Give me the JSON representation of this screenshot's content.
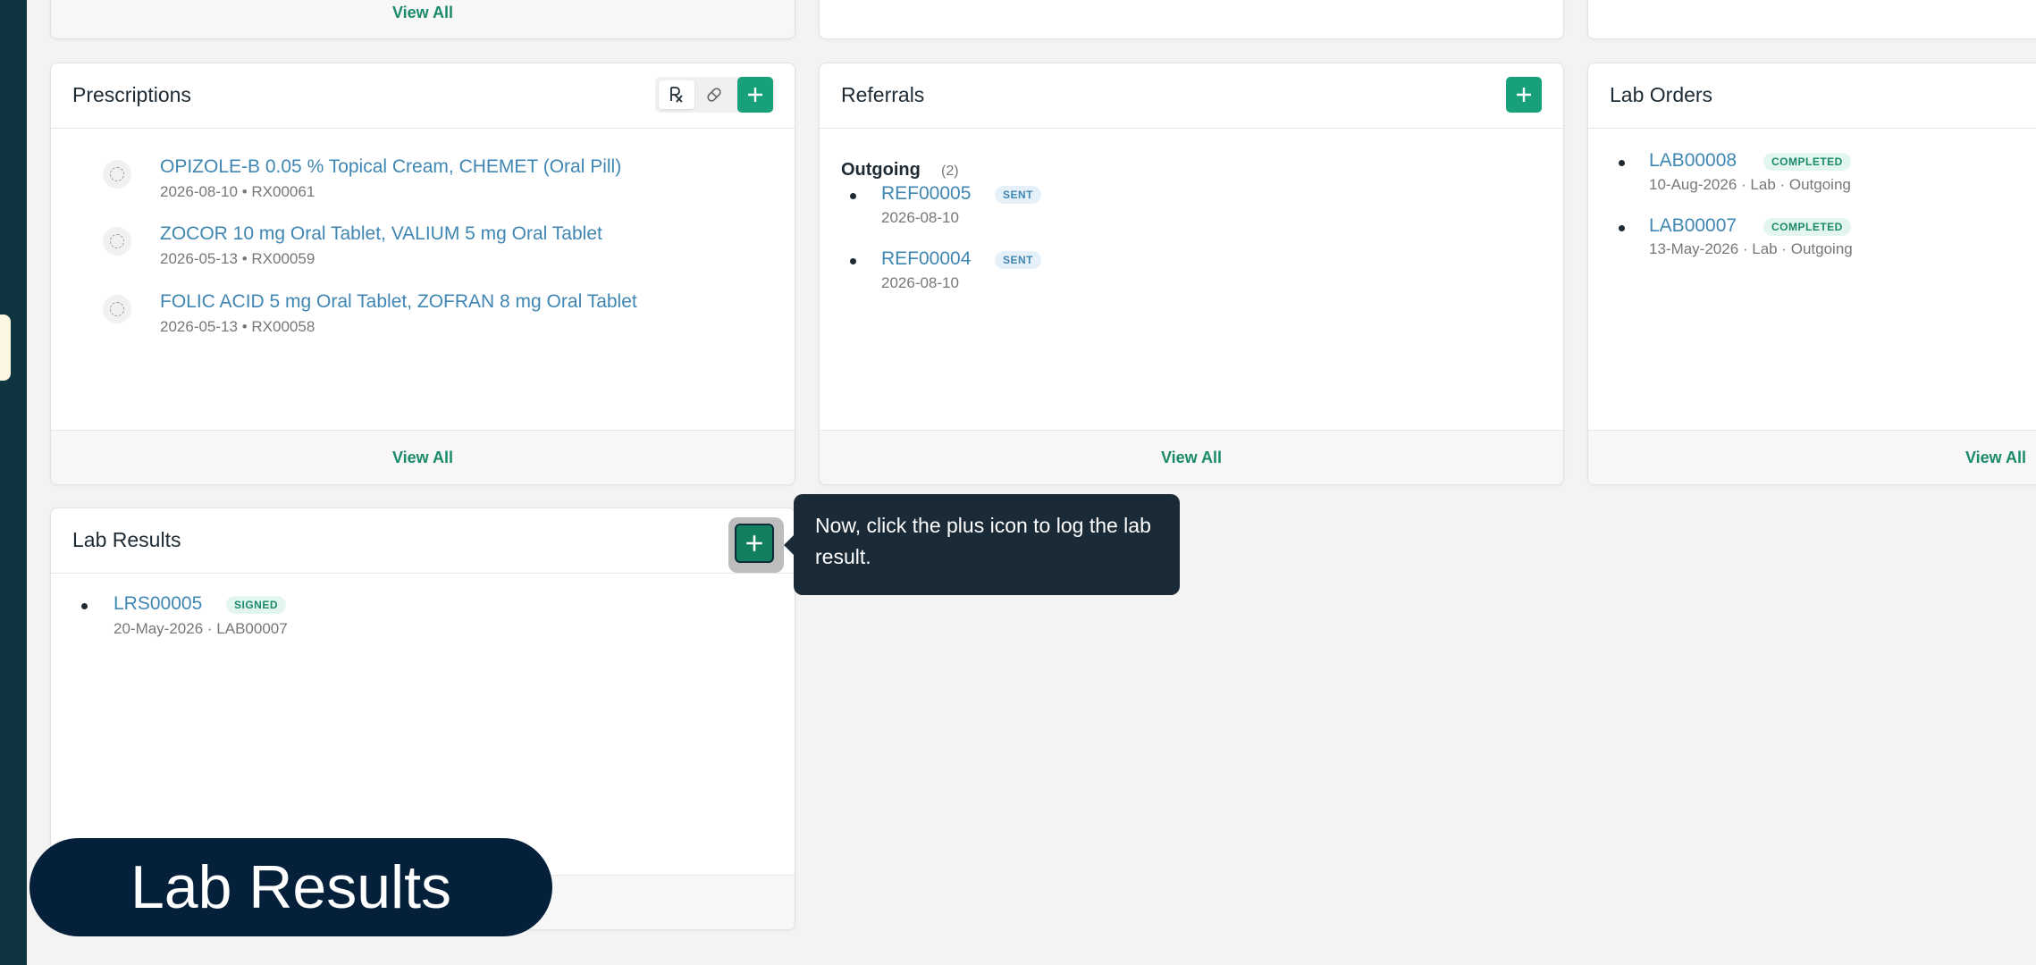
{
  "top_row": {
    "view_all_label": "View All"
  },
  "prescriptions": {
    "title": "Prescriptions",
    "items": [
      {
        "name": "OPIZOLE-B 0.05 % Topical Cream, CHEMET (Oral Pill)",
        "date": "2026-08-10",
        "id": "RX00061"
      },
      {
        "name": "ZOCOR 10 mg Oral Tablet, VALIUM 5 mg Oral Tablet",
        "date": "2026-05-13",
        "id": "RX00059"
      },
      {
        "name": "FOLIC ACID 5 mg Oral Tablet, ZOFRAN 8 mg Oral Tablet",
        "date": "2026-05-13",
        "id": "RX00058"
      }
    ],
    "separator": "•",
    "view_all_label": "View All"
  },
  "referrals": {
    "title": "Referrals",
    "group_label": "Outgoing",
    "group_count": "(2)",
    "items": [
      {
        "id": "REF00005",
        "status": "SENT",
        "date": "2026-08-10"
      },
      {
        "id": "REF00004",
        "status": "SENT",
        "date": "2026-08-10"
      }
    ],
    "view_all_label": "View All"
  },
  "lab_orders": {
    "title": "Lab Orders",
    "items": [
      {
        "id": "LAB00008",
        "status": "COMPLETED",
        "meta": "10-Aug-2026  · Lab · Outgoing"
      },
      {
        "id": "LAB00007",
        "status": "COMPLETED",
        "meta": "13-May-2026  · Lab · Outgoing"
      }
    ],
    "view_all_label": "View All"
  },
  "lab_results": {
    "title": "Lab Results",
    "items": [
      {
        "id": "LRS00005",
        "status": "SIGNED",
        "meta": "20-May-2026  · LAB00007"
      }
    ]
  },
  "tooltip": {
    "text": "Now, click the plus icon to log the lab result."
  },
  "caption": {
    "text": "Lab Results"
  },
  "colors": {
    "accent": "#17a07a",
    "link": "#3f86b3",
    "sidebar": "#0f3540",
    "tooltip_bg": "#1b2a37",
    "caption_bg": "#04203a"
  }
}
